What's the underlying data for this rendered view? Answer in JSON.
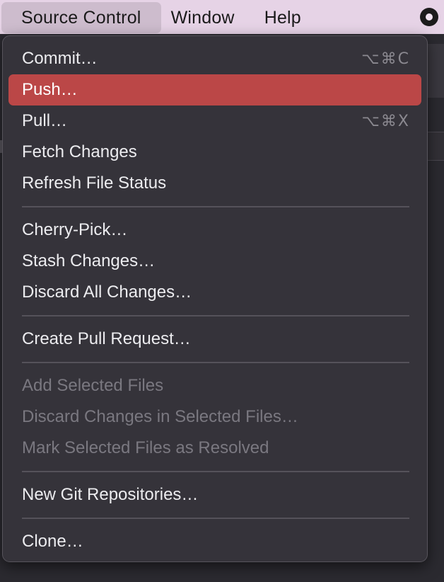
{
  "menubar": {
    "items": [
      {
        "label": "Source Control",
        "active": true
      },
      {
        "label": "Window",
        "active": false
      },
      {
        "label": "Help",
        "active": false
      }
    ],
    "status_icon": "record-icon"
  },
  "menu": {
    "items": [
      {
        "label": "Commit…",
        "shortcut": "⌥⌘C",
        "state": "normal"
      },
      {
        "label": "Push…",
        "shortcut": "",
        "state": "selected"
      },
      {
        "label": "Pull…",
        "shortcut": "⌥⌘X",
        "state": "normal"
      },
      {
        "label": "Fetch Changes",
        "shortcut": "",
        "state": "normal"
      },
      {
        "label": "Refresh File Status",
        "shortcut": "",
        "state": "normal"
      },
      {
        "label": "Cherry-Pick…",
        "shortcut": "",
        "state": "normal"
      },
      {
        "label": "Stash Changes…",
        "shortcut": "",
        "state": "normal"
      },
      {
        "label": "Discard All Changes…",
        "shortcut": "",
        "state": "normal"
      },
      {
        "label": "Create Pull Request…",
        "shortcut": "",
        "state": "normal"
      },
      {
        "label": "Add Selected Files",
        "shortcut": "",
        "state": "disabled"
      },
      {
        "label": "Discard Changes in Selected Files…",
        "shortcut": "",
        "state": "disabled"
      },
      {
        "label": "Mark Selected Files as Resolved",
        "shortcut": "",
        "state": "disabled"
      },
      {
        "label": "New Git Repositories…",
        "shortcut": "",
        "state": "normal"
      },
      {
        "label": "Clone…",
        "shortcut": "",
        "state": "normal"
      }
    ]
  },
  "colors": {
    "menubar_bg": "#e6d3e6",
    "menu_bg": "#35333a",
    "selection": "#bb4747",
    "disabled_text": "#7a7880"
  }
}
